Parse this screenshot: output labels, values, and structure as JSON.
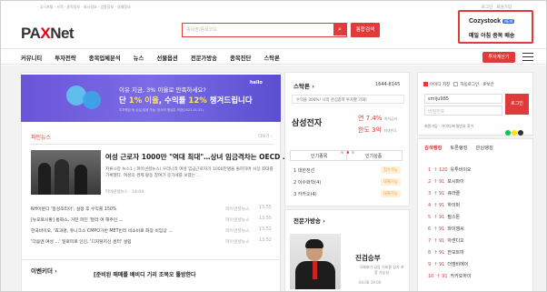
{
  "top": {
    "nav_text": "- 공시포털 · 가격 · 종목정보 · 회사정보 · 업종정보 · 경제정보",
    "links": [
      "로그인",
      "회원가입"
    ]
  },
  "logo": {
    "prefix": "PA",
    "x": "X",
    "suffix": "Net"
  },
  "search": {
    "placeholder": "종목명/종목코드",
    "button": "통합검색",
    "icon": "search-icon"
  },
  "ad": {
    "brand": "Cozystock",
    "tag": "NEW",
    "desc": "매일 아침 종목 배송"
  },
  "menu": {
    "items": [
      "커뮤니티",
      "투자전략",
      "종목업체분석",
      "뉴스",
      "선물옵션",
      "전문가방송",
      "종목진단",
      "스탁론"
    ],
    "calc_button": "투자계산기"
  },
  "banner": {
    "line1": "이유 지금, 3% 이율로 만족하세요?",
    "line2_a": "단 ",
    "line2_b": "1% 이율",
    "line2_c": ", 수익률 ",
    "line2_d": "12%",
    "line2_e": " 챙겨드립니다",
    "line3": "투자원금 등 손실 발생 가능, 당사의 원금은 보장(2022.01.22)",
    "brand": "hello"
  },
  "news": {
    "section": "파인뉴스",
    "more": "더보기 ›",
    "headline": "여성 근로자 1000만 \"역대 최대\"…상녀 임금격차는 OECD …",
    "summary": "저류시장 뉴스1 | 파이낸셜뉴스) 우리나라 여성 임금근로자가 1000만명을 돌파하며 사상 최대를 기록했다. 여성의 경제 활동 참여가 증가세를 보였는 …",
    "source": "파이낸셜뉴스 · 14:04",
    "rows": [
      {
        "title": "NH아문디 '일성조리아', 설정 후 수익률 150%",
        "source": "파이낸셜뉴스",
        "time": "13:55"
      },
      {
        "title": "[뉴포토시황] 통화스, 거란 파진 '달라 여 해주인 …",
        "source": "파이낸셜뉴스",
        "time": "13:55"
      },
      {
        "title": "한국바이오, '효과명, 유니크스 CMPO가반 MET빈리 비소비로 화장 비임상 …",
        "source": "파이낸셜뉴스",
        "time": "13:52"
      },
      {
        "title": "'다음엔 여성 …' 일로피로 인인, '디지털지신 센터' 설립",
        "source": "파이낸셜뉴스",
        "time": "13:52"
      }
    ]
  },
  "bottom": {
    "title": "이벤키더 ›",
    "sub": "[준비된 매매를 배비디 기리 조목오 툴방한다"
  },
  "stockcon": {
    "title": "스탁론 ›",
    "phone": "1644-8145",
    "notice": "수익을 300%! 나의 관심종목 투자할 기회!",
    "stock_name": "삼성전자",
    "stock_value": "연 7.4%",
    "stock_value_sub": "최저금리",
    "stock_value2": "한도 3억",
    "stock_value2_sub": "최대한도",
    "tab1": "인기종목",
    "tab2": "인기상품",
    "ranks": [
      {
        "n": "1",
        "name": "대한전선",
        "badge": "접수가능"
      },
      {
        "n": "2",
        "name": "이수화학(4)",
        "badge": "대출가능"
      },
      {
        "n": "3",
        "name": "카카오(4)",
        "badge": "대출가능"
      }
    ]
  },
  "expert": {
    "title": "전문가방송 ›",
    "name": "진검승부",
    "desc": "국제표가 급등 이포들 삼자 포함 가능성",
    "date": "04.08 19:00"
  },
  "login": {
    "opt1": "아이디 저장",
    "opt2": "자동로그인",
    "opt3": "IP보안",
    "id": "smiju985",
    "pw_placeholder": "비밀번호",
    "button": "로그인",
    "links": "회원가입 · 아이디/비밀번호 찾기",
    "social": [
      "naver",
      "kakao",
      "google"
    ]
  },
  "ranking": {
    "tabs": [
      "검색랭킹",
      "토론랭킹",
      "관심랭킹"
    ],
    "items": [
      {
        "n": "1",
        "chg": "↑ 120",
        "name": "유투비이오"
      },
      {
        "n": "2",
        "chg": "↑ 91",
        "name": "포시파이"
      },
      {
        "n": "3",
        "chg": "↑ 91",
        "name": "큐라클"
      },
      {
        "n": "4",
        "chg": "↑ 91",
        "name": "하이퍼"
      },
      {
        "n": "5",
        "chg": "↑ 91",
        "name": "필스톤"
      },
      {
        "n": "6",
        "chg": "↑ 91",
        "name": "와이엠씨"
      },
      {
        "n": "7",
        "chg": "↑ 91",
        "name": "아센디오"
      },
      {
        "n": "8",
        "chg": "↑ 91",
        "name": "한보트마"
      },
      {
        "n": "9",
        "chg": "↑ 91",
        "name": "더엠비에이"
      },
      {
        "n": "10",
        "chg": "↑ 91",
        "name": "카카오하이"
      }
    ]
  },
  "colors": {
    "accent": "#e03a3a",
    "banner": "#6a55d8",
    "text": "#222222"
  }
}
